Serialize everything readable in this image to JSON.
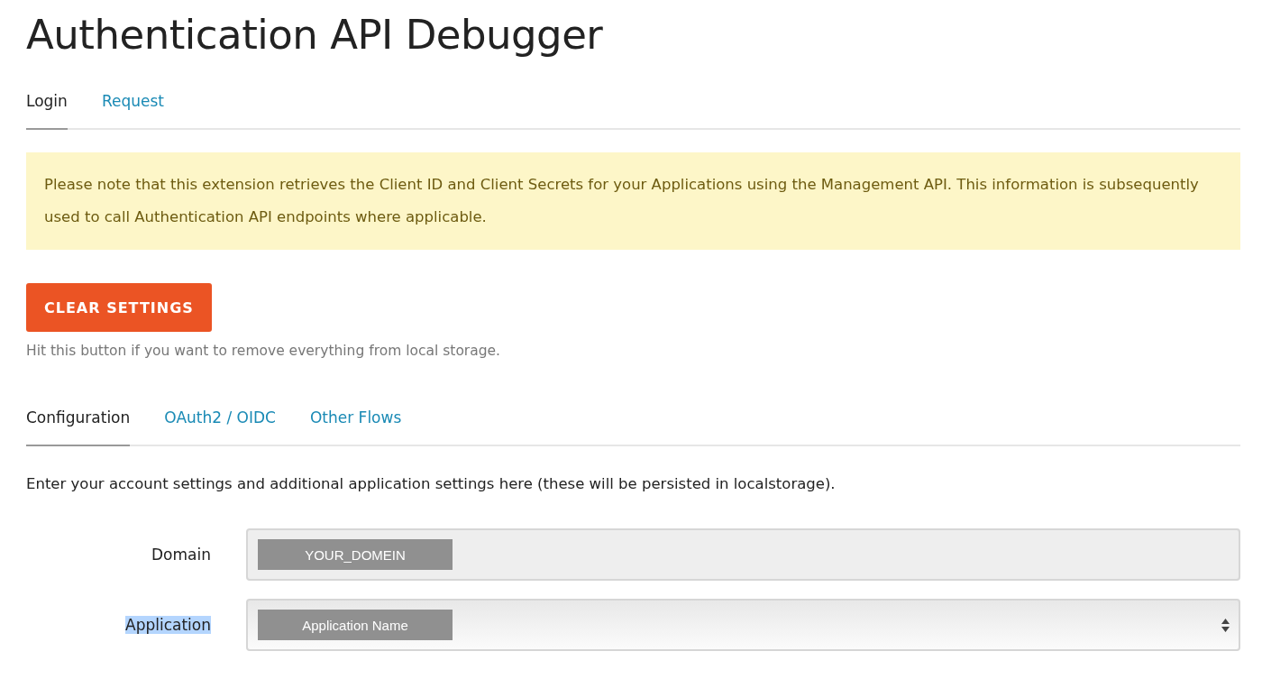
{
  "title": "Authentication API Debugger",
  "tabs": [
    {
      "label": "Login",
      "selected": true
    },
    {
      "label": "Request",
      "selected": false
    }
  ],
  "notice": "Please note that this extension retrieves the Client ID and Client Secrets for your Applications using the Management API. This information is subsequently used to call Authentication API endpoints where applicable.",
  "clear_button": "CLEAR SETTINGS",
  "clear_help": "Hit this button if you want to remove everything from local storage.",
  "subtabs": [
    {
      "label": "Configuration",
      "selected": true
    },
    {
      "label": "OAuth2 / OIDC",
      "selected": false
    },
    {
      "label": "Other Flows",
      "selected": false
    }
  ],
  "intro": "Enter your account settings and additional application settings here (these will be persisted in localstorage).",
  "fields": [
    {
      "kind": "text",
      "label": "Domain",
      "label_highlighted": false,
      "value": "YOUR_DOMEIN"
    },
    {
      "kind": "select",
      "label": "Application",
      "label_highlighted": true,
      "value": "Application Name"
    }
  ]
}
